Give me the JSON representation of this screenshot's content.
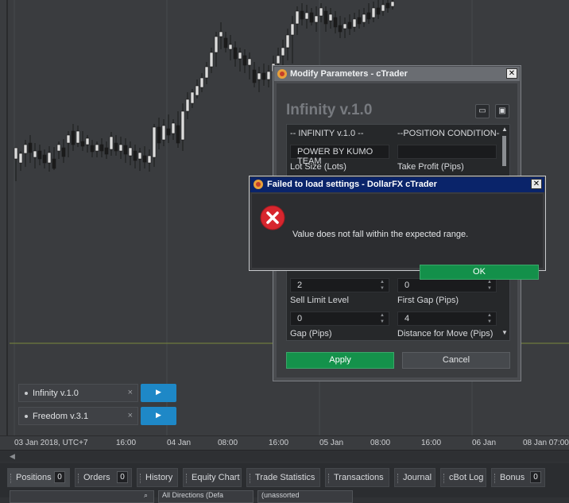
{
  "chart": {
    "time_labels": [
      "03 Jan 2018, UTC+7",
      "16:00",
      "04 Jan",
      "08:00",
      "16:00",
      "05 Jan",
      "08:00",
      "16:00",
      "06 Jan",
      "08 Jan 07:00"
    ],
    "colors": {
      "background": "#3a3c3f",
      "candle_up": "#dcdcdc",
      "candle_down": "#1b1b1b",
      "level_line": "#7a8a3c"
    }
  },
  "bots": [
    {
      "name": "Infinity v.1.0",
      "close": "×",
      "play": "▶"
    },
    {
      "name": "Freedom v.3.1",
      "close": "×",
      "play": "▶"
    }
  ],
  "bottom_tabs": [
    {
      "label": "Positions",
      "count": "0"
    },
    {
      "label": "Orders",
      "count": "0"
    },
    {
      "label": "History"
    },
    {
      "label": "Equity Chart"
    },
    {
      "label": "Trade Statistics"
    },
    {
      "label": "Transactions"
    },
    {
      "label": "Journal"
    },
    {
      "label": "cBot Log"
    },
    {
      "label": "Bonus",
      "count": "0"
    }
  ],
  "filters": [
    "All Directions (Defa",
    "(unassorted"
  ],
  "modify_dialog": {
    "title": "Modify Parameters - cTrader",
    "close": "✕",
    "panel_title": "Infinity v.1.0",
    "icons": [
      "open-folder-icon",
      "save-icon"
    ],
    "params": {
      "header_left": "-- INFINITY v.1.0 --",
      "header_right": "--POSITION CONDITION--",
      "power_value": "POWER BY KUMO TEAM",
      "empty_value": "",
      "lot_size_label": "Lot Size (Lots)",
      "take_profit_label": "Take Profit (Pips)",
      "value_a": "2",
      "value_b": "0",
      "sell_limit_label": "Sell Limit Level",
      "first_gap_label": "First Gap (Pips)",
      "value_c": "0",
      "value_d": "4",
      "gap_label": "Gap (Pips)",
      "distance_label": "Distance for Move (Pips)"
    },
    "apply_label": "Apply",
    "cancel_label": "Cancel"
  },
  "error_dialog": {
    "title": "Failed to load settings - DollarFX cTrader",
    "close": "✕",
    "message": "Value does not fall within the expected range.",
    "ok_label": "OK",
    "icon": "error-icon"
  }
}
